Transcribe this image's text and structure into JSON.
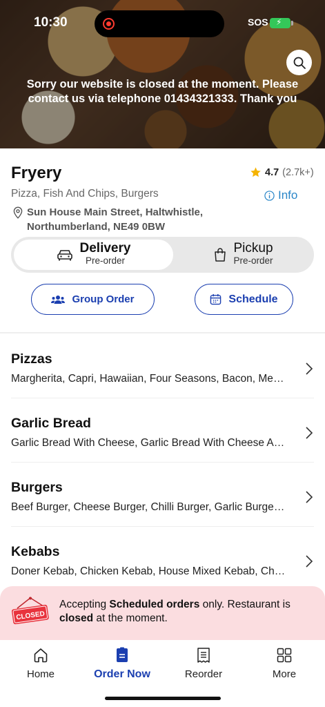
{
  "status_bar": {
    "time": "10:30",
    "sos": "SOS"
  },
  "hero": {
    "message": "Sorry our website is closed at the moment. Please contact us via telephone 01434321333. Thank you",
    "search_icon": "search-icon"
  },
  "restaurant": {
    "name": "Fryery",
    "rating_score": "4.7",
    "rating_count": "(2.7k+)",
    "cuisines": "Pizza, Fish And Chips, Burgers",
    "info_label": "Info",
    "address_line1": "Sun House Main Street, Haltwhistle,",
    "address_line2": "Northumberland, NE49 0BW"
  },
  "order_mode": {
    "delivery": {
      "title": "Delivery",
      "subtitle": "Pre-order"
    },
    "pickup": {
      "title": "Pickup",
      "subtitle": "Pre-order"
    }
  },
  "actions": {
    "group_order": "Group Order",
    "schedule": "Schedule"
  },
  "categories": [
    {
      "title": "Pizzas",
      "items": "Margherita, Capri, Hawaiian, Four Seasons, Bacon, Mexican, Meat Feast"
    },
    {
      "title": "Garlic Bread",
      "items": "Garlic Bread With Cheese, Garlic Bread With Cheese And Tomato"
    },
    {
      "title": "Burgers",
      "items": "Beef Burger, Cheese Burger, Chilli Burger, Garlic Burger, Bacon Burger"
    },
    {
      "title": "Kebabs",
      "items": "Doner Kebab, Chicken Kebab, House Mixed Kebab, Chicken Shish"
    }
  ],
  "closed_banner": {
    "sign_text": "CLOSED",
    "prefix": "Accepting ",
    "bold1": "Scheduled orders",
    "middle": " only. Restaurant is ",
    "bold2": "closed",
    "suffix": " at the moment."
  },
  "bottom_nav": [
    {
      "label": "Home"
    },
    {
      "label": "Order Now"
    },
    {
      "label": "Reorder"
    },
    {
      "label": "More"
    }
  ],
  "colors": {
    "accent": "#1b3fb0",
    "info": "#2a86c8",
    "star": "#f5b301",
    "banner_bg": "#fbdde0",
    "closed_red": "#e8333d"
  }
}
